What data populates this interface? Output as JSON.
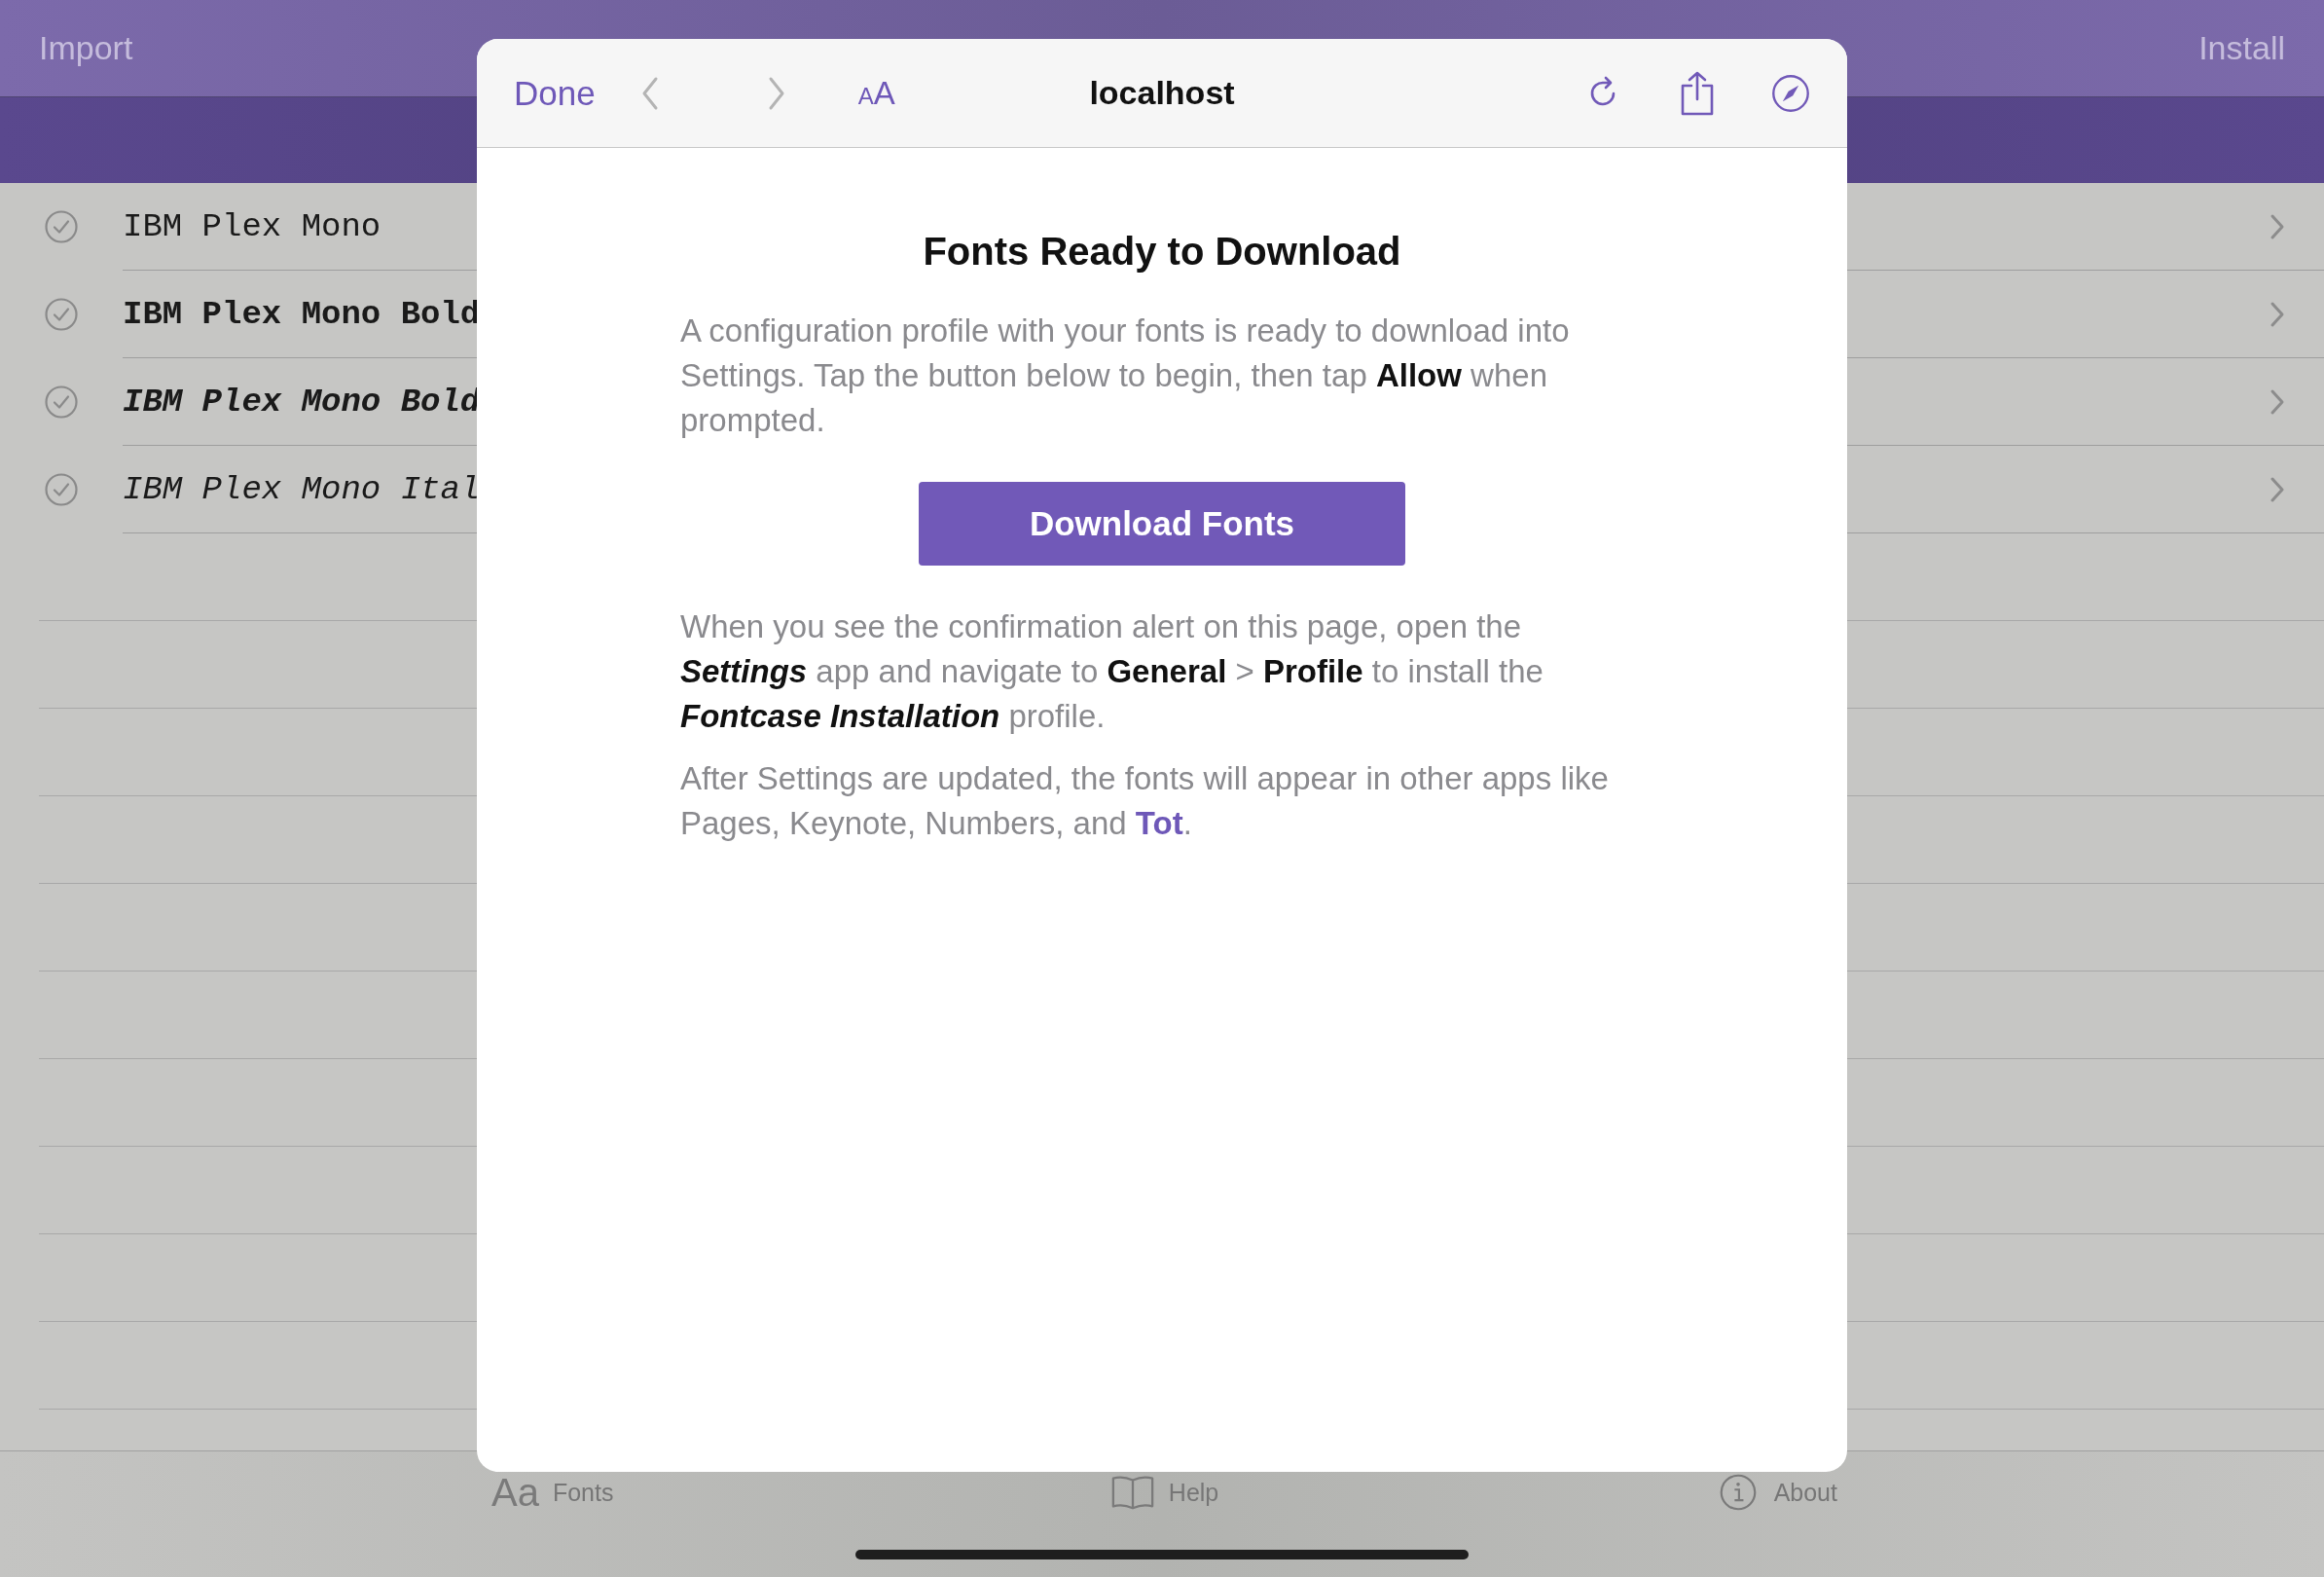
{
  "nav_bar": {
    "left_button": "Import",
    "right_button": "Install"
  },
  "font_list": [
    {
      "name": "IBM Plex Mono",
      "kind": "regular"
    },
    {
      "name": "IBM Plex Mono Bold",
      "kind": "bold"
    },
    {
      "name": "IBM Plex Mono Bold",
      "kind": "bold-italic"
    },
    {
      "name": "IBM Plex Mono Ital",
      "kind": "italic"
    }
  ],
  "tab_bar": [
    {
      "icon_text": "Aa",
      "label": "Fonts",
      "kind": "glyph"
    },
    {
      "label": "Help",
      "kind": "book"
    },
    {
      "label": "About",
      "kind": "info"
    }
  ],
  "browser": {
    "done": "Done",
    "back_disabled": true,
    "forward_disabled": true,
    "text_size": "AA",
    "address": "localhost",
    "title": "Fonts Ready to Download",
    "intro": "A configuration profile with your fonts is ready to download into Settings. Tap the button below to begin, then tap **Allow** when prompted.",
    "button": "Download Fonts",
    "instructions": "When you see the confirmation alert on this page, open the *Settings* app and navigate to **General** > **Profile** to install the *Fontcase Installation* profile.",
    "footer": {
      "before": "After Settings are updated, the fonts will appear in other apps like Pages, Keynote, Numbers, and ",
      "link": "Tot",
      "after": "."
    }
  }
}
